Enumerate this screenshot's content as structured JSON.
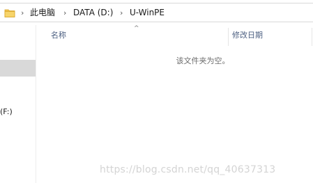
{
  "address_bar": {
    "folder_icon": "folder-icon",
    "separator": "›",
    "breadcrumbs": [
      "此电脑",
      "DATA (D:)",
      "U-WinPE"
    ]
  },
  "nav_pane": {
    "drive_label": "(F:)"
  },
  "columns": {
    "sort_indicator": "^",
    "name": "名称",
    "date_modified": "修改日期"
  },
  "empty_message": "该文件夹为空。",
  "watermark": "https://blog.csdn.net/qq_40637313",
  "colors": {
    "header_text": "#4d6082",
    "folder_yellow": "#f0c24b",
    "selection_gray": "#d9d9d9"
  }
}
